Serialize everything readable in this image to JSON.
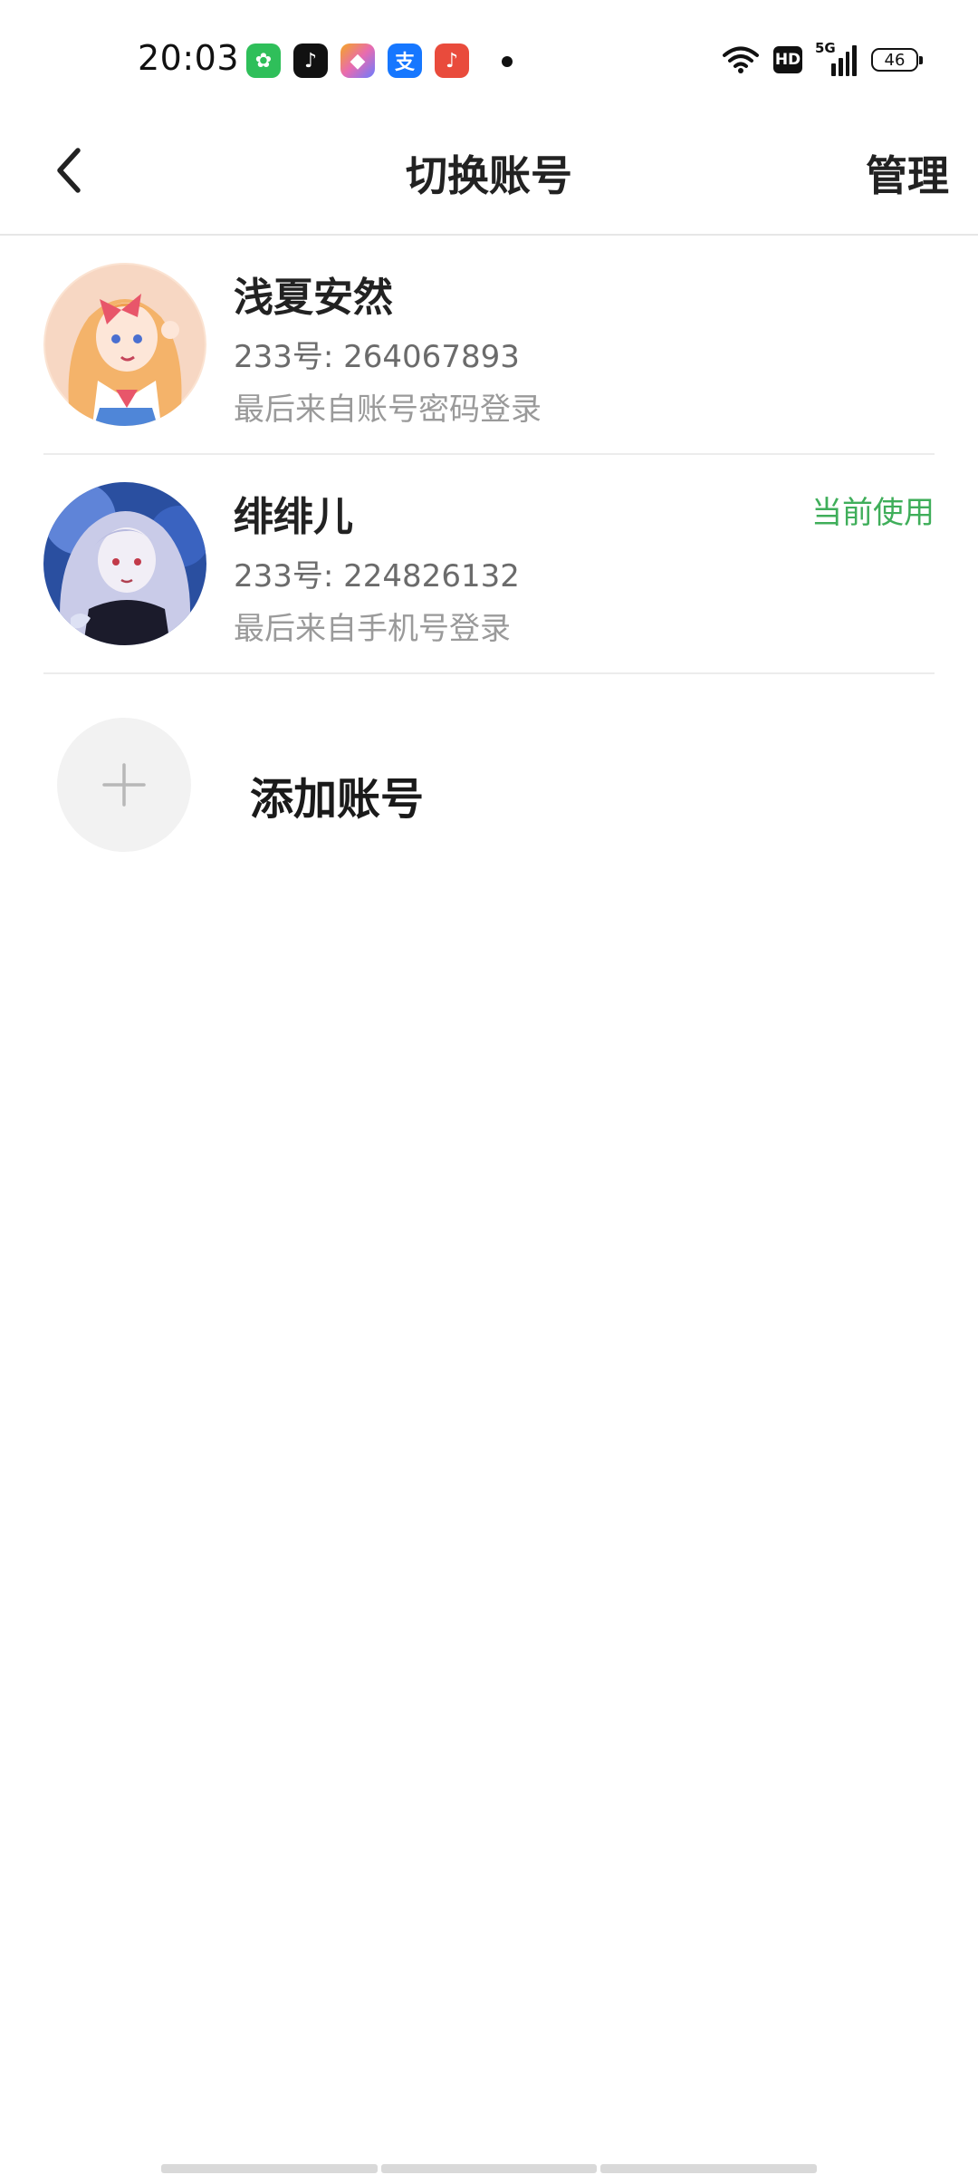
{
  "status_bar": {
    "time": "20:03",
    "apps": [
      {
        "icon": "wechat-like-green-app-icon",
        "color": "#2fbf5a",
        "glyph": "✿"
      },
      {
        "icon": "tiktok-icon",
        "color": "#111111",
        "glyph": "♪"
      },
      {
        "icon": "colorful-app-icon",
        "color": "#e86bb0",
        "glyph": "◆"
      },
      {
        "icon": "alipay-icon",
        "color": "#1677ff",
        "glyph": "支"
      },
      {
        "icon": "music-app-icon",
        "color": "#e94b3c",
        "glyph": "♪"
      }
    ],
    "hd": "HD",
    "network": "5G",
    "battery": "46"
  },
  "header": {
    "title": "切换账号",
    "manage_label": "管理"
  },
  "accounts": [
    {
      "name": "浅夏安然",
      "id_text": "233号: 264067893",
      "login_method": "最后来自账号密码登录",
      "current_label": ""
    },
    {
      "name": "绯绯儿",
      "id_text": "233号: 224826132",
      "login_method": "最后来自手机号登录",
      "current_label": "当前使用"
    }
  ],
  "add_account": {
    "label": "添加账号"
  },
  "colors": {
    "accent_green": "#3fae5a",
    "divider": "#ececec"
  }
}
